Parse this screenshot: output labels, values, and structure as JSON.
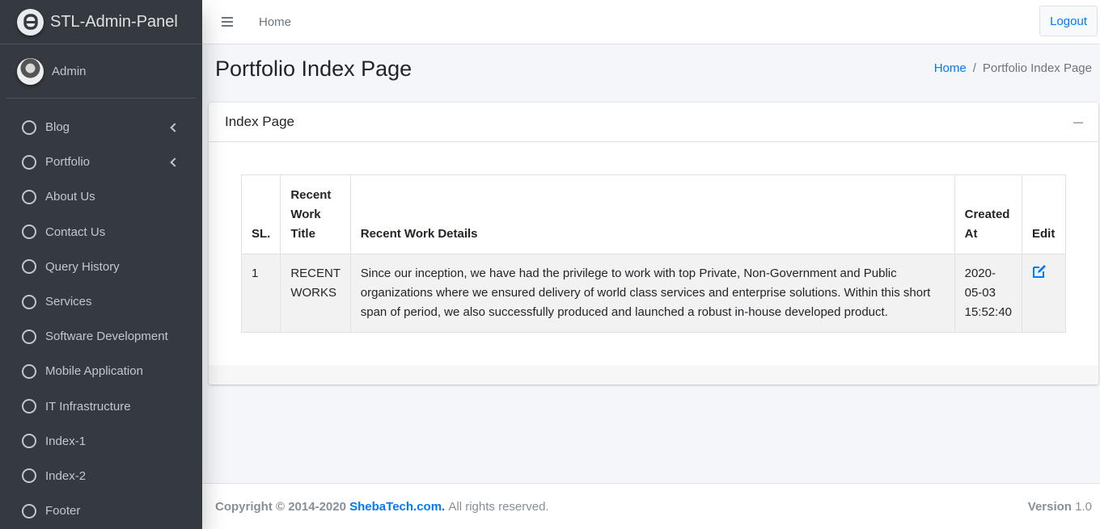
{
  "brand": {
    "name": "STL-Admin-Panel"
  },
  "user": {
    "name": "Admin"
  },
  "sidebar": {
    "items": [
      {
        "label": "Blog",
        "has_submenu": true
      },
      {
        "label": "Portfolio",
        "has_submenu": true
      },
      {
        "label": "About Us"
      },
      {
        "label": "Contact Us"
      },
      {
        "label": "Query History"
      },
      {
        "label": "Services"
      },
      {
        "label": "Software Development"
      },
      {
        "label": "Mobile Application"
      },
      {
        "label": "IT Infrastructure"
      },
      {
        "label": "Index-1"
      },
      {
        "label": "Index-2"
      },
      {
        "label": "Footer"
      }
    ]
  },
  "navbar": {
    "home": "Home",
    "logout": "Logout"
  },
  "header": {
    "title": "Portfolio Index Page",
    "breadcrumb": {
      "home": "Home",
      "separator": "/",
      "current": "Portfolio Index Page"
    }
  },
  "card": {
    "title": "Index Page",
    "table": {
      "columns": [
        "SL.",
        "Recent Work Title",
        "Recent Work Details",
        "Created At",
        "Edit"
      ],
      "rows": [
        {
          "sl": "1",
          "title": "RECENT WORKS",
          "details": "Since our inception, we have had the privilege to work with top Private, Non-Government and Public organizations where we ensured delivery of world class services and enterprise solutions. Within this short span of period, we also successfully produced and launched a robust in-house developed product.",
          "created_at": "2020-05-03 15:52:40"
        }
      ]
    }
  },
  "footer": {
    "copyright": "Copyright © 2014-2020",
    "link": "ShebaTech.com.",
    "rights": "All rights reserved.",
    "version_label": "Version",
    "version": "1.0"
  },
  "colors": {
    "sidebar_bg": "#343a40",
    "accent": "#007bff",
    "page_bg": "#f4f6f9"
  }
}
